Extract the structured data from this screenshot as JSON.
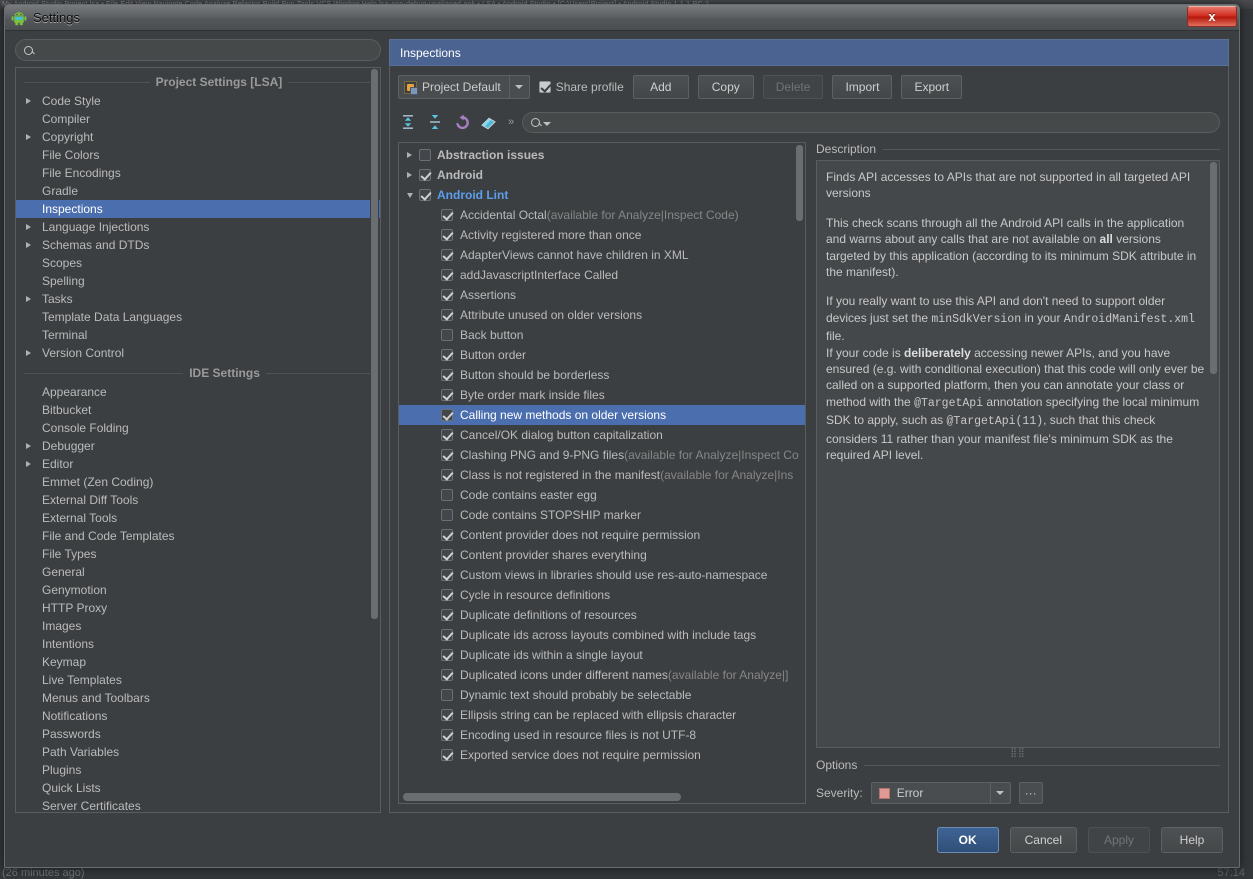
{
  "background": {
    "menubar_text": "My Android Studio Project.lsa  •  File  Edit  View  Navigate  Code  Analyze  Refactor  Build  Run  Tools  VCS  Window  Help        lsa-app-debug-unaligned.apk  •  LSA  •  Android Studio  •  [C:\\Users\\Project]  •  Android Studio 1.1.1 RC 2",
    "bottom_left": "(26 minutes ago)",
    "bottom_right": "57:14"
  },
  "titlebar": {
    "title": "Settings",
    "icon": "android-icon",
    "close_label": "x"
  },
  "left": {
    "search_placeholder": "",
    "search_value": "",
    "search_icon": "search-icon",
    "sections": [
      {
        "header": "Project Settings [LSA]",
        "items": [
          {
            "label": "Code Style",
            "expandable": true,
            "selected": false
          },
          {
            "label": "Compiler",
            "expandable": false,
            "selected": false
          },
          {
            "label": "Copyright",
            "expandable": true,
            "selected": false
          },
          {
            "label": "File Colors",
            "expandable": false,
            "selected": false
          },
          {
            "label": "File Encodings",
            "expandable": false,
            "selected": false
          },
          {
            "label": "Gradle",
            "expandable": false,
            "selected": false
          },
          {
            "label": "Inspections",
            "expandable": false,
            "selected": true
          },
          {
            "label": "Language Injections",
            "expandable": true,
            "selected": false
          },
          {
            "label": "Schemas and DTDs",
            "expandable": true,
            "selected": false
          },
          {
            "label": "Scopes",
            "expandable": false,
            "selected": false
          },
          {
            "label": "Spelling",
            "expandable": false,
            "selected": false
          },
          {
            "label": "Tasks",
            "expandable": true,
            "selected": false
          },
          {
            "label": "Template Data Languages",
            "expandable": false,
            "selected": false
          },
          {
            "label": "Terminal",
            "expandable": false,
            "selected": false
          },
          {
            "label": "Version Control",
            "expandable": true,
            "selected": false
          }
        ]
      },
      {
        "header": "IDE Settings",
        "items": [
          {
            "label": "Appearance",
            "expandable": false,
            "selected": false
          },
          {
            "label": "Bitbucket",
            "expandable": false,
            "selected": false
          },
          {
            "label": "Console Folding",
            "expandable": false,
            "selected": false
          },
          {
            "label": "Debugger",
            "expandable": true,
            "selected": false
          },
          {
            "label": "Editor",
            "expandable": true,
            "selected": false
          },
          {
            "label": "Emmet (Zen Coding)",
            "expandable": false,
            "selected": false
          },
          {
            "label": "External Diff Tools",
            "expandable": false,
            "selected": false
          },
          {
            "label": "External Tools",
            "expandable": false,
            "selected": false
          },
          {
            "label": "File and Code Templates",
            "expandable": false,
            "selected": false
          },
          {
            "label": "File Types",
            "expandable": false,
            "selected": false
          },
          {
            "label": "General",
            "expandable": false,
            "selected": false
          },
          {
            "label": "Genymotion",
            "expandable": false,
            "selected": false
          },
          {
            "label": "HTTP Proxy",
            "expandable": false,
            "selected": false
          },
          {
            "label": "Images",
            "expandable": false,
            "selected": false
          },
          {
            "label": "Intentions",
            "expandable": false,
            "selected": false
          },
          {
            "label": "Keymap",
            "expandable": false,
            "selected": false
          },
          {
            "label": "Live Templates",
            "expandable": false,
            "selected": false
          },
          {
            "label": "Menus and Toolbars",
            "expandable": false,
            "selected": false
          },
          {
            "label": "Notifications",
            "expandable": false,
            "selected": false
          },
          {
            "label": "Passwords",
            "expandable": false,
            "selected": false
          },
          {
            "label": "Path Variables",
            "expandable": false,
            "selected": false
          },
          {
            "label": "Plugins",
            "expandable": false,
            "selected": false
          },
          {
            "label": "Quick Lists",
            "expandable": false,
            "selected": false
          },
          {
            "label": "Server Certificates",
            "expandable": false,
            "selected": false
          }
        ]
      }
    ]
  },
  "right": {
    "banner_title": "Inspections",
    "profile": {
      "selected": "Project Default",
      "icon": "project-icon",
      "share_label": "Share profile",
      "share_checked": true
    },
    "buttons": [
      {
        "label": "Add",
        "underline": "d",
        "disabled": false
      },
      {
        "label": "Copy",
        "underline": "C",
        "disabled": false
      },
      {
        "label": "Delete",
        "underline": "",
        "disabled": true
      },
      {
        "label": "Import",
        "underline": "I",
        "disabled": false
      },
      {
        "label": "Export",
        "underline": "E",
        "disabled": false
      }
    ],
    "toolbar_icons": [
      "expand-all-icon",
      "collapse-all-icon",
      "reset-undo-icon",
      "eraser-icon"
    ],
    "toolbar_chevron": "»",
    "tree_search_placeholder": "",
    "tree_search_value": "",
    "tree_search_icon": "search-filter-icon",
    "tree": [
      {
        "level": 0,
        "label": "Abstraction issues",
        "suffix": "",
        "state": "unchecked",
        "twisty": "right",
        "bold": true,
        "blue": false,
        "selected": false
      },
      {
        "level": 0,
        "label": "Android",
        "suffix": "",
        "state": "checked",
        "twisty": "right",
        "bold": true,
        "blue": false,
        "selected": false
      },
      {
        "level": 0,
        "label": "Android Lint",
        "suffix": "",
        "state": "checked",
        "twisty": "down",
        "bold": true,
        "blue": true,
        "selected": false
      },
      {
        "level": 1,
        "label": "Accidental Octal",
        "suffix": " (available for Analyze|Inspect Code)",
        "state": "checked",
        "twisty": "",
        "bold": false,
        "blue": false,
        "selected": false
      },
      {
        "level": 1,
        "label": "Activity registered more than once",
        "suffix": "",
        "state": "checked",
        "twisty": "",
        "bold": false,
        "blue": false,
        "selected": false
      },
      {
        "level": 1,
        "label": "AdapterViews cannot have children in XML",
        "suffix": "",
        "state": "checked",
        "twisty": "",
        "bold": false,
        "blue": false,
        "selected": false
      },
      {
        "level": 1,
        "label": "addJavascriptInterface Called",
        "suffix": "",
        "state": "checked",
        "twisty": "",
        "bold": false,
        "blue": false,
        "selected": false
      },
      {
        "level": 1,
        "label": "Assertions",
        "suffix": "",
        "state": "checked",
        "twisty": "",
        "bold": false,
        "blue": false,
        "selected": false
      },
      {
        "level": 1,
        "label": "Attribute unused on older versions",
        "suffix": "",
        "state": "checked",
        "twisty": "",
        "bold": false,
        "blue": false,
        "selected": false
      },
      {
        "level": 1,
        "label": "Back button",
        "suffix": "",
        "state": "unchecked",
        "twisty": "",
        "bold": false,
        "blue": false,
        "selected": false
      },
      {
        "level": 1,
        "label": "Button order",
        "suffix": "",
        "state": "checked",
        "twisty": "",
        "bold": false,
        "blue": false,
        "selected": false
      },
      {
        "level": 1,
        "label": "Button should be borderless",
        "suffix": "",
        "state": "checked",
        "twisty": "",
        "bold": false,
        "blue": false,
        "selected": false
      },
      {
        "level": 1,
        "label": "Byte order mark inside files",
        "suffix": "",
        "state": "checked",
        "twisty": "",
        "bold": false,
        "blue": false,
        "selected": false
      },
      {
        "level": 1,
        "label": "Calling new methods on older versions",
        "suffix": "",
        "state": "checked",
        "twisty": "",
        "bold": false,
        "blue": false,
        "selected": true
      },
      {
        "level": 1,
        "label": "Cancel/OK dialog button capitalization",
        "suffix": "",
        "state": "checked",
        "twisty": "",
        "bold": false,
        "blue": false,
        "selected": false
      },
      {
        "level": 1,
        "label": "Clashing PNG and 9-PNG files",
        "suffix": " (available for Analyze|Inspect Co",
        "state": "checked",
        "twisty": "",
        "bold": false,
        "blue": false,
        "selected": false
      },
      {
        "level": 1,
        "label": "Class is not registered in the manifest",
        "suffix": " (available for Analyze|Ins",
        "state": "checked",
        "twisty": "",
        "bold": false,
        "blue": false,
        "selected": false
      },
      {
        "level": 1,
        "label": "Code contains easter egg",
        "suffix": "",
        "state": "unchecked",
        "twisty": "",
        "bold": false,
        "blue": false,
        "selected": false
      },
      {
        "level": 1,
        "label": "Code contains STOPSHIP marker",
        "suffix": "",
        "state": "unchecked",
        "twisty": "",
        "bold": false,
        "blue": false,
        "selected": false
      },
      {
        "level": 1,
        "label": "Content provider does not require permission",
        "suffix": "",
        "state": "checked",
        "twisty": "",
        "bold": false,
        "blue": false,
        "selected": false
      },
      {
        "level": 1,
        "label": "Content provider shares everything",
        "suffix": "",
        "state": "checked",
        "twisty": "",
        "bold": false,
        "blue": false,
        "selected": false
      },
      {
        "level": 1,
        "label": "Custom views in libraries should use res-auto-namespace",
        "suffix": "",
        "state": "checked",
        "twisty": "",
        "bold": false,
        "blue": false,
        "selected": false
      },
      {
        "level": 1,
        "label": "Cycle in resource definitions",
        "suffix": "",
        "state": "checked",
        "twisty": "",
        "bold": false,
        "blue": false,
        "selected": false
      },
      {
        "level": 1,
        "label": "Duplicate definitions of resources",
        "suffix": "",
        "state": "checked",
        "twisty": "",
        "bold": false,
        "blue": false,
        "selected": false
      },
      {
        "level": 1,
        "label": "Duplicate ids across layouts combined with include tags",
        "suffix": "",
        "state": "checked",
        "twisty": "",
        "bold": false,
        "blue": false,
        "selected": false
      },
      {
        "level": 1,
        "label": "Duplicate ids within a single layout",
        "suffix": "",
        "state": "checked",
        "twisty": "",
        "bold": false,
        "blue": false,
        "selected": false
      },
      {
        "level": 1,
        "label": "Duplicated icons under different names",
        "suffix": " (available for Analyze|]",
        "state": "checked",
        "twisty": "",
        "bold": false,
        "blue": false,
        "selected": false
      },
      {
        "level": 1,
        "label": "Dynamic text should probably be selectable",
        "suffix": "",
        "state": "unchecked",
        "twisty": "",
        "bold": false,
        "blue": false,
        "selected": false
      },
      {
        "level": 1,
        "label": "Ellipsis string can be replaced with ellipsis character",
        "suffix": "",
        "state": "checked",
        "twisty": "",
        "bold": false,
        "blue": false,
        "selected": false
      },
      {
        "level": 1,
        "label": "Encoding used in resource files is not UTF-8",
        "suffix": "",
        "state": "checked",
        "twisty": "",
        "bold": false,
        "blue": false,
        "selected": false
      },
      {
        "level": 1,
        "label": "Exported service does not require permission",
        "suffix": "",
        "state": "checked",
        "twisty": "",
        "bold": false,
        "blue": false,
        "selected": false
      }
    ],
    "description": {
      "header": "Description",
      "para1": "Finds API accesses to APIs that are not supported in all targeted API versions",
      "para2_a": "This check scans through all the Android API calls in the application and warns about any calls that are not available on ",
      "para2_bold": "all",
      "para2_b": " versions targeted by this application (according to its minimum SDK attribute in the manifest).",
      "para3_a": "If you really want to use this API and don't need to support older devices just set the ",
      "para3_code1": "minSdkVersion",
      "para3_b": " in your ",
      "para3_code2": "AndroidManifest.xml",
      "para3_c": " file.",
      "para4_a": "If your code is ",
      "para4_bold": "deliberately",
      "para4_b": " accessing newer APIs, and you have ensured (e.g. with conditional execution) that this code will only ever be called on a supported platform, then you can annotate your class or method with the ",
      "para4_code1": "@TargetApi",
      "para4_c": " annotation specifying the local minimum SDK to apply, such as ",
      "para4_code2": "@TargetApi(11)",
      "para4_d": ", such that this check considers 11 rather than your manifest file's minimum SDK as the required API level."
    },
    "options": {
      "header": "Options",
      "severity_label": "Severity:",
      "severity_value": "Error",
      "severity_color": "#e09a96",
      "more_label": "···"
    }
  },
  "footer": {
    "buttons": [
      {
        "label": "OK",
        "primary": true,
        "disabled": false
      },
      {
        "label": "Cancel",
        "primary": false,
        "disabled": false
      },
      {
        "label": "Apply",
        "primary": false,
        "disabled": true
      },
      {
        "label": "Help",
        "primary": false,
        "disabled": false
      }
    ]
  }
}
